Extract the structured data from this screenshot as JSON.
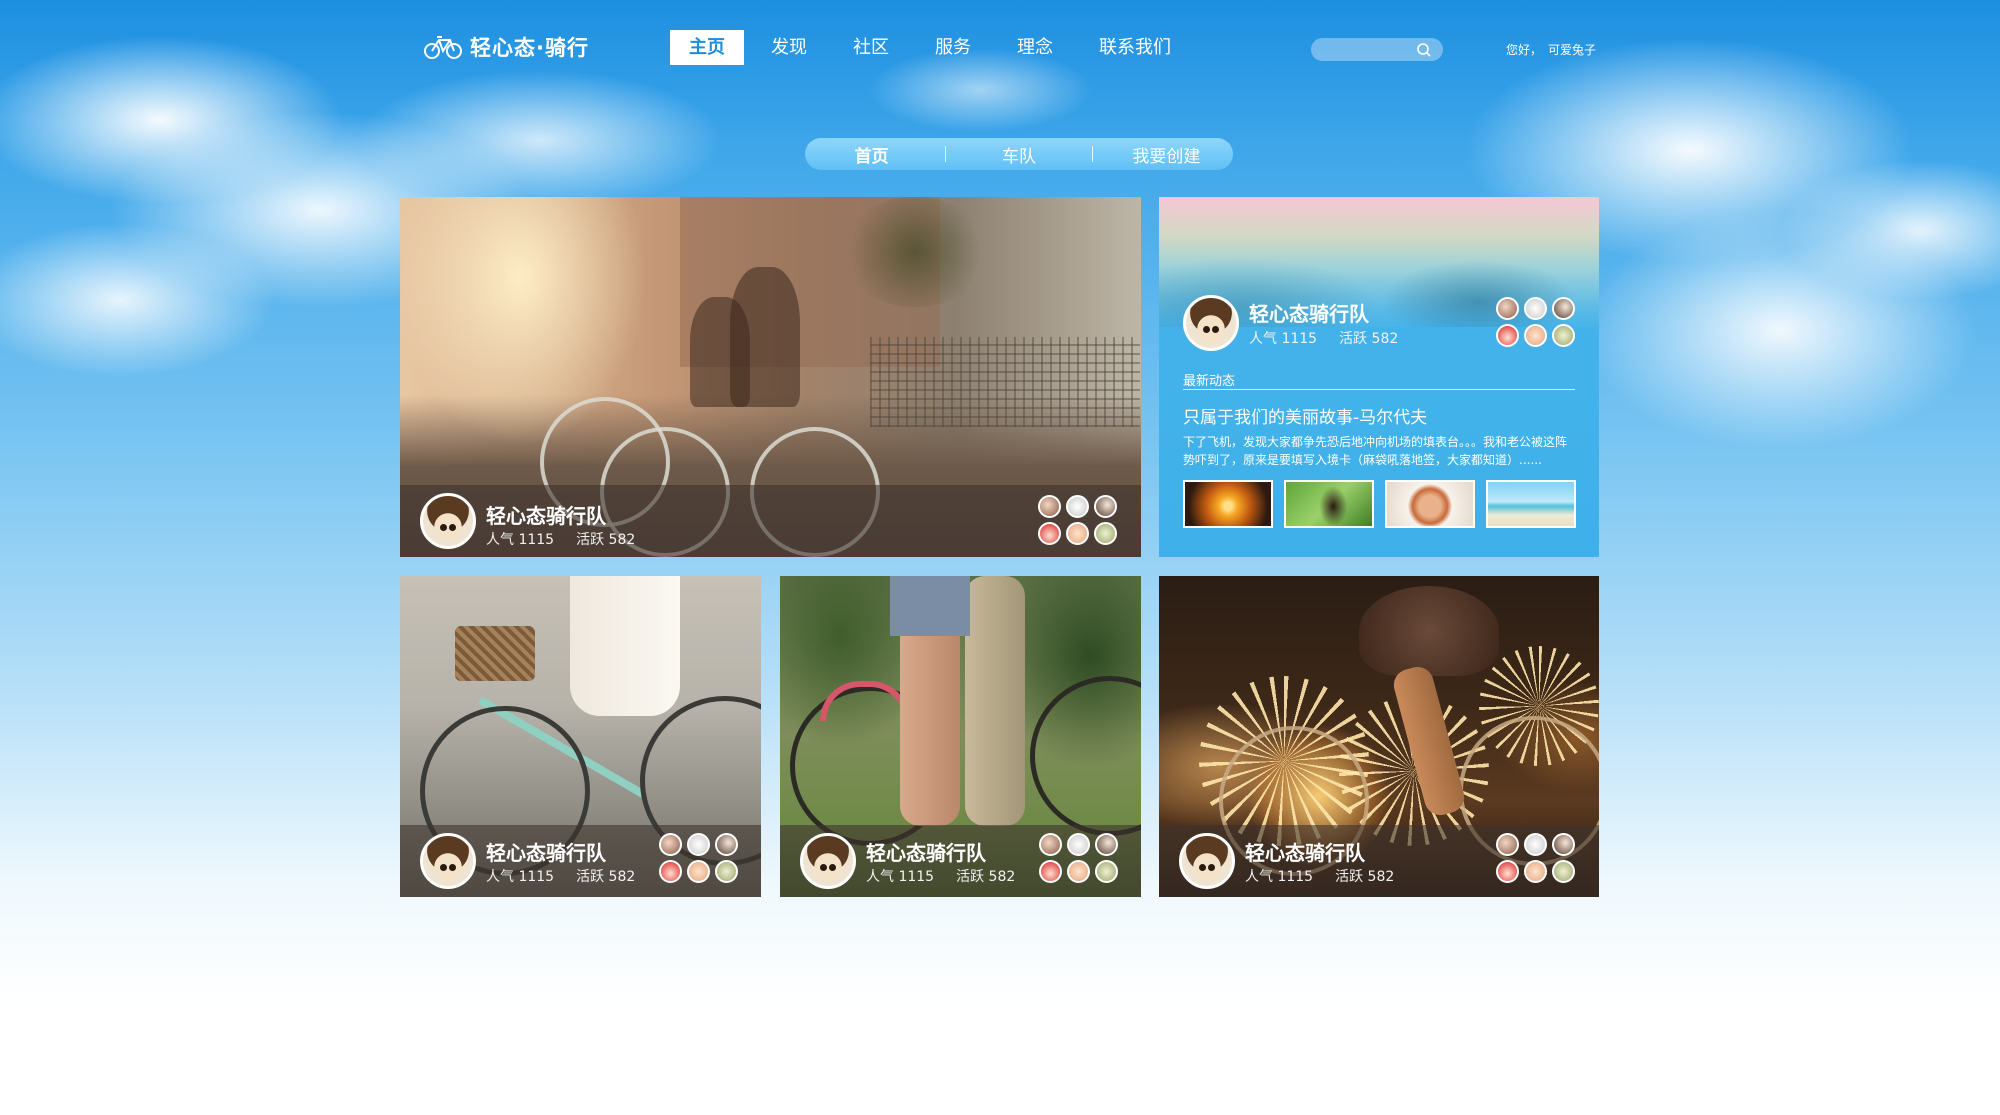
{
  "header": {
    "logo_text": "轻心态·骑行",
    "nav": [
      {
        "label": "主页",
        "active": true
      },
      {
        "label": "发现",
        "active": false
      },
      {
        "label": "社区",
        "active": false
      },
      {
        "label": "服务",
        "active": false
      },
      {
        "label": "理念",
        "active": false
      },
      {
        "label": "联系我们",
        "active": false
      }
    ],
    "search": {
      "placeholder": "",
      "icon": "search-icon"
    },
    "greeting": "您好，",
    "username": "可爱兔子"
  },
  "subnav": {
    "items": [
      {
        "label": "首页",
        "active": true
      },
      {
        "label": "车队",
        "active": false
      },
      {
        "label": "我要创建",
        "active": false
      }
    ]
  },
  "cards": [
    {
      "team": "轻心态骑行队",
      "popularity": "人气 1115",
      "activity": "活跃 582"
    },
    {
      "team": "轻心态骑行队",
      "popularity": "人气 1115",
      "activity": "活跃 582"
    },
    {
      "team": "轻心态骑行队",
      "popularity": "人气 1115",
      "activity": "活跃 582"
    },
    {
      "team": "轻心态骑行队",
      "popularity": "人气 1115",
      "activity": "活跃 582"
    }
  ],
  "feature": {
    "team": "轻心态骑行队",
    "popularity": "人气 1115",
    "activity": "活跃 582",
    "section_title": "最新动态",
    "news_title": "只属于我们的美丽故事-马尔代夫",
    "news_body": "下了飞机，发现大家都争先恐后地冲向机场的填表台。。。我和老公被这阵势吓到了，原来是要填写入境卡（麻袋吼落地签，大家都知道）......"
  },
  "colors": {
    "accent": "#1b8fdf",
    "feature_bg": "#3fb0ea",
    "overlay": "rgba(60,50,45,0.58)"
  }
}
